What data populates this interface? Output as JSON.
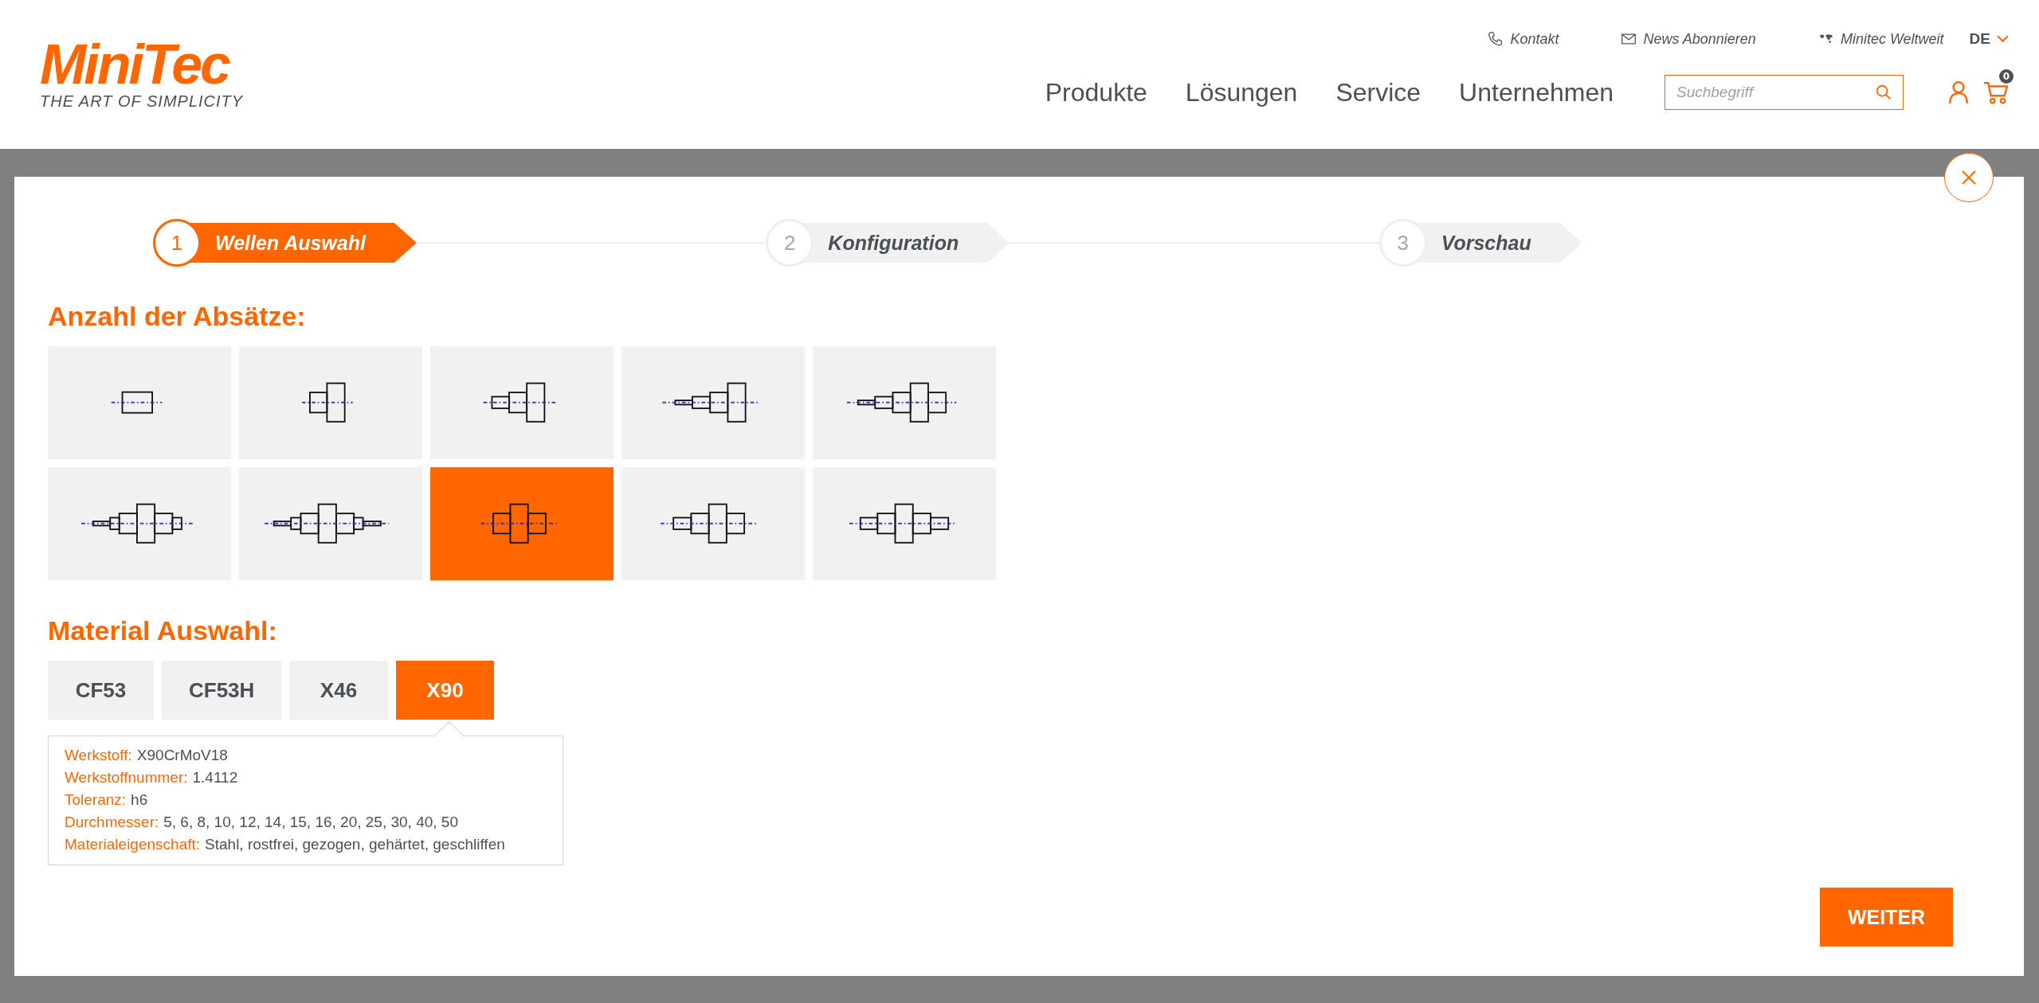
{
  "header": {
    "logo": {
      "name": "MiniTec",
      "tagline": "THE ART OF SIMPLICITY"
    },
    "top_links": [
      {
        "kind": "phone",
        "label": "Kontakt"
      },
      {
        "kind": "mail",
        "label": "News Abonnieren"
      },
      {
        "kind": "world",
        "label": "Minitec Weltweit"
      }
    ],
    "language": "DE",
    "nav": [
      "Produkte",
      "Lösungen",
      "Service",
      "Unternehmen"
    ],
    "search": {
      "placeholder": "Suchbegriff"
    },
    "cart": {
      "count": "0"
    }
  },
  "steps": [
    {
      "number": "1",
      "label": "Wellen Auswahl",
      "selected": true
    },
    {
      "number": "2",
      "label": "Konfiguration",
      "selected": false
    },
    {
      "number": "3",
      "label": "Vorschau",
      "selected": false
    }
  ],
  "steps_section": {
    "title": "Anzahl der Absätze:",
    "options": [
      {
        "selected": false
      },
      {
        "selected": false
      },
      {
        "selected": false
      },
      {
        "selected": false
      },
      {
        "selected": false
      },
      {
        "selected": false
      },
      {
        "selected": false
      },
      {
        "selected": true
      },
      {
        "selected": false
      },
      {
        "selected": false
      }
    ]
  },
  "material_section": {
    "title": "Material Auswahl:",
    "options": [
      {
        "label": "CF53",
        "selected": false
      },
      {
        "label": "CF53H",
        "selected": false
      },
      {
        "label": "X46",
        "selected": false
      },
      {
        "label": "X90",
        "selected": true
      }
    ],
    "details": [
      {
        "label": "Werkstoff:",
        "value": "X90CrMoV18"
      },
      {
        "label": "Werkstoffnummer:",
        "value": "1.4112"
      },
      {
        "label": "Toleranz:",
        "value": "h6"
      },
      {
        "label": "Durchmesser:",
        "value": "5, 6, 8, 10, 12, 14, 15, 16, 20, 25, 30, 40, 50"
      },
      {
        "label": "Materialeigenschaft:",
        "value": "Stahl, rostfrei, gezogen, gehärtet, geschliffen"
      }
    ]
  },
  "next_button": "WEITER"
}
